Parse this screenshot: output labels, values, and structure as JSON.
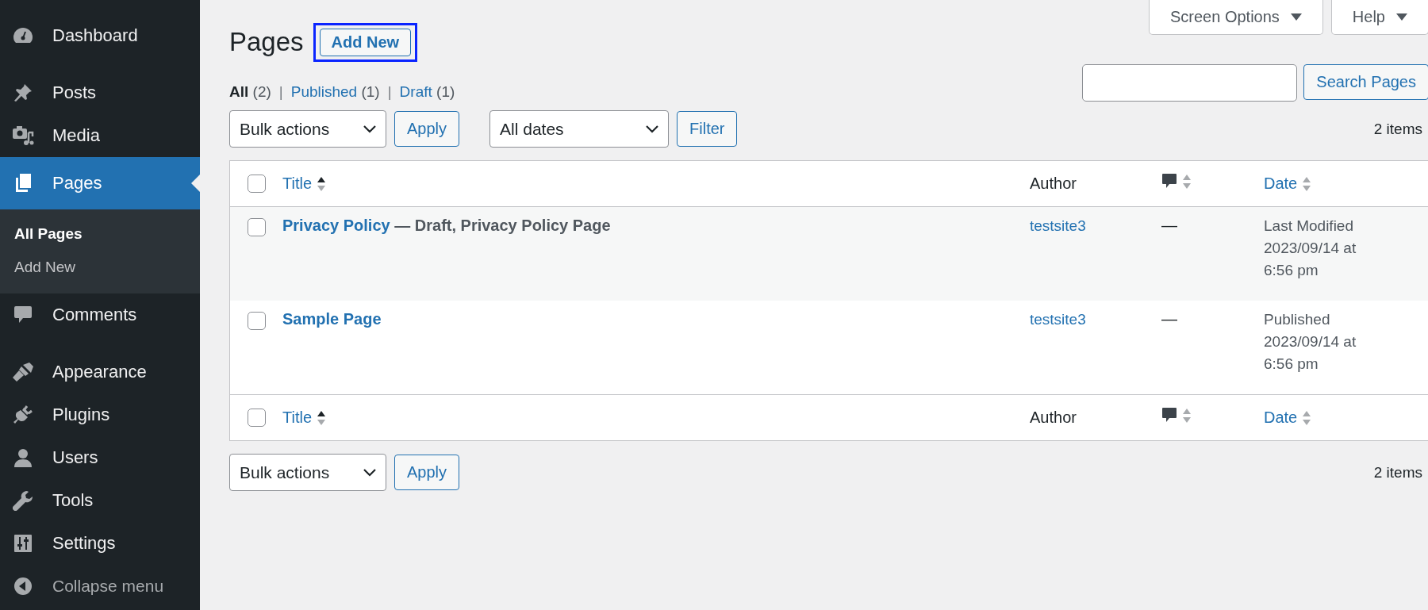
{
  "sidebar": {
    "items": [
      {
        "label": "Dashboard",
        "selected": false
      },
      {
        "label": "Posts",
        "selected": false
      },
      {
        "label": "Media",
        "selected": false
      },
      {
        "label": "Pages",
        "selected": true,
        "submenu": [
          {
            "label": "All Pages",
            "selected": true
          },
          {
            "label": "Add New",
            "selected": false
          }
        ]
      },
      {
        "label": "Comments",
        "selected": false
      },
      {
        "label": "Appearance",
        "selected": false
      },
      {
        "label": "Plugins",
        "selected": false
      },
      {
        "label": "Users",
        "selected": false
      },
      {
        "label": "Tools",
        "selected": false
      },
      {
        "label": "Settings",
        "selected": false
      }
    ],
    "collapse": "Collapse menu"
  },
  "screen_meta": [
    {
      "label": "Screen Options"
    },
    {
      "label": "Help"
    }
  ],
  "heading": "Pages",
  "add_new": {
    "label": "Add New",
    "highlighted": true
  },
  "views": [
    {
      "label": "All",
      "count": "(2)",
      "selected": true
    },
    {
      "separator": "|",
      "label": "Published",
      "count": "(1)",
      "selected": false
    },
    {
      "separator": "|",
      "label": "Draft",
      "count": "(1)",
      "selected": false
    }
  ],
  "search": {
    "button": "Search Pages"
  },
  "tablenav_top": {
    "bulk": "Bulk actions",
    "apply": "Apply",
    "dates": "All dates",
    "filter": "Filter",
    "count": "2 items"
  },
  "table": {
    "columns": [
      {
        "kind": "title",
        "label": "Title",
        "sorted": true
      },
      {
        "kind": "text",
        "label": "Author"
      },
      {
        "kind": "comments",
        "sorted": false
      },
      {
        "kind": "sortable",
        "label": "Date",
        "sorted": false
      }
    ],
    "footer_columns": [
      {
        "kind": "title",
        "label": "Title",
        "sorted": true
      },
      {
        "kind": "text",
        "label": "Author"
      },
      {
        "kind": "comments",
        "sorted": false
      },
      {
        "kind": "sortable",
        "label": "Date",
        "sorted": false
      }
    ],
    "header_checked": false,
    "footer_checked": false,
    "rows": [
      {
        "title": "Privacy Policy",
        "state": "— Draft, Privacy Policy Page",
        "author": "testsite3",
        "comments": "—",
        "date_status": "Last Modified",
        "date": "2023/09/14 at",
        "time": "6:56 pm",
        "checked": false
      },
      {
        "title": "Sample Page",
        "author": "testsite3",
        "comments": "—",
        "date_status": "Published",
        "date": "2023/09/14 at",
        "time": "6:56 pm",
        "checked": false
      }
    ]
  },
  "tablenav_bottom": {
    "bulk": "Bulk actions",
    "apply": "Apply",
    "count": "2 items"
  }
}
